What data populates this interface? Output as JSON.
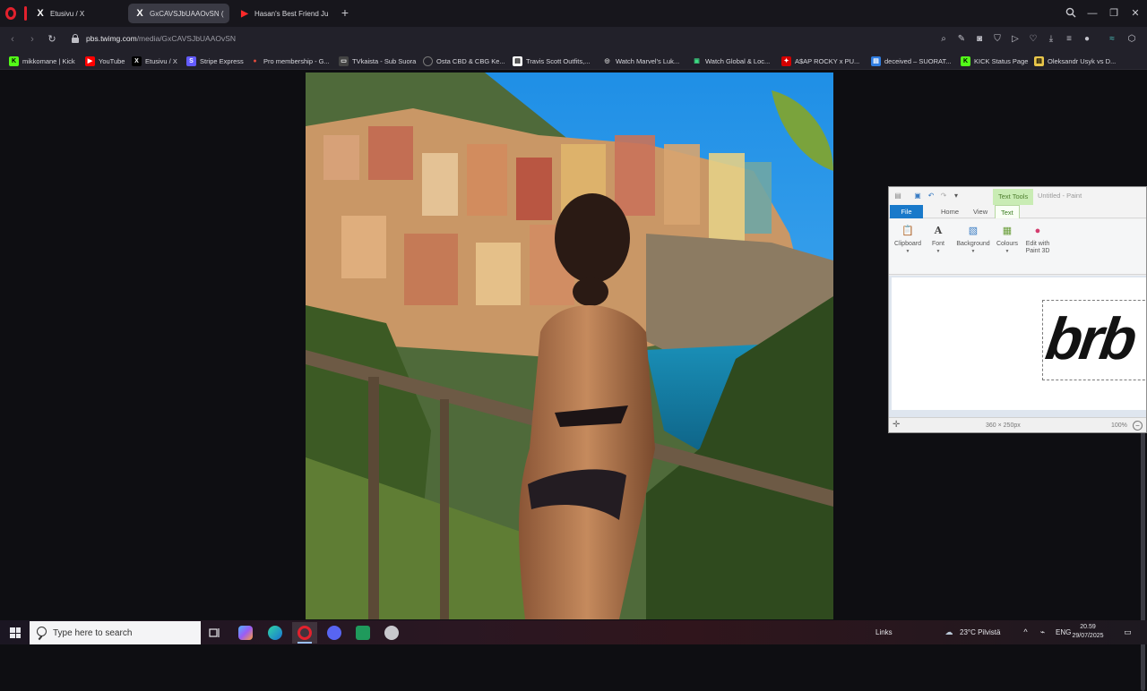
{
  "browser": {
    "tabs": [
      {
        "title": "Etusivu / X",
        "icon": "x-logo-icon",
        "active": false
      },
      {
        "title": "GxCAVSJbUAAOvSN (13",
        "icon": "x-logo-icon",
        "active": true
      },
      {
        "title": "Hasan's Best Friend Just G",
        "icon": "youtube-icon",
        "active": false
      }
    ],
    "url_domain": "pbs.twimg.com",
    "url_path": "/media/GxCAVSJbUAAOvSN",
    "bookmarks": [
      {
        "label": "mikkomane | Kick",
        "icon": "kick-icon",
        "color": "#53fc18"
      },
      {
        "label": "YouTube",
        "icon": "youtube-icon",
        "color": "#ff0000"
      },
      {
        "label": "Etusivu / X",
        "icon": "x-logo-icon",
        "color": "#000000"
      },
      {
        "label": "Stripe Express",
        "icon": "stripe-icon",
        "color": "#635bff"
      },
      {
        "label": "Pro membership - G...",
        "icon": "pin-icon",
        "color": "#e24a3b"
      },
      {
        "label": "TVkaista - Sub Suora",
        "icon": "tv-icon",
        "color": "#444444"
      },
      {
        "label": "Osta CBD & CBG Ke...",
        "icon": "globe-icon",
        "color": "#666666"
      },
      {
        "label": "Travis Scott Outfits,...",
        "icon": "page-icon",
        "color": "#ffffff"
      },
      {
        "label": "Watch Marvel's Luk...",
        "icon": "globe-icon",
        "color": "#888888"
      },
      {
        "label": "Watch Global & Loc...",
        "icon": "android-icon",
        "color": "#3ddc84"
      },
      {
        "label": "A$AP ROCKY x PU...",
        "icon": "puma-icon",
        "color": "#d40000"
      },
      {
        "label": "deceived – SUORAT...",
        "icon": "page-icon",
        "color": "#2f7de1"
      },
      {
        "label": "KICK Status Page",
        "icon": "kick-icon",
        "color": "#53fc18"
      },
      {
        "label": "Oleksandr Usyk vs D...",
        "icon": "page-icon",
        "color": "#e9c64a"
      }
    ]
  },
  "paint": {
    "context_tab": "Text Tools",
    "window_title": "Untitled - Paint",
    "tabs": [
      "File",
      "Home",
      "View",
      "Text"
    ],
    "groups": [
      {
        "label": "Clipboard",
        "icon": "clipboard-icon"
      },
      {
        "label": "Font",
        "icon": "font-icon"
      },
      {
        "label": "Background",
        "icon": "background-icon"
      },
      {
        "label": "Colours",
        "icon": "colours-icon"
      },
      {
        "label": "Edit with Paint 3D",
        "icon": "paint3d-icon"
      }
    ],
    "canvas_text": "brb",
    "canvas_size": "360 × 250px",
    "zoom": "100%"
  },
  "taskbar": {
    "search_placeholder": "Type here to search",
    "links_label": "Links",
    "weather": "23°C  Pilvistä",
    "language": "ENG",
    "time": "20.59",
    "date": "29/07/2025"
  }
}
